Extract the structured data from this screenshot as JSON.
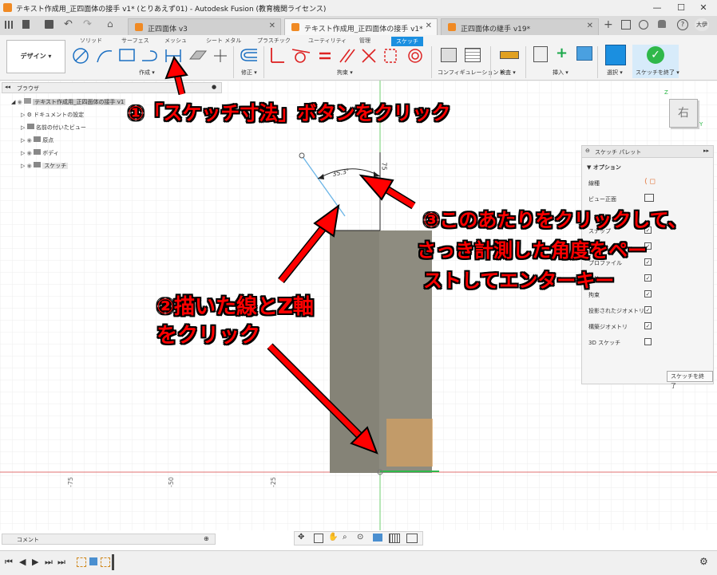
{
  "window": {
    "title": "テキスト作成用_正四面体の接手 v1* (とりあえず01) - Autodesk Fusion (教育機関ライセンス)",
    "minimize": "—",
    "maximize": "☐",
    "close": "✕"
  },
  "tabs": [
    {
      "label": "正四面体 v3"
    },
    {
      "label": "テキスト作成用_正四面体の接手 v1*"
    },
    {
      "label": "正四面体の継手 v19*"
    }
  ],
  "user": {
    "initials": "大伊"
  },
  "toolbar": {
    "workspace": "デザイン ▾",
    "tabs": [
      "ソリッド",
      "サーフェス",
      "メッシュ",
      "シート メタル",
      "プラスチック",
      "ユーティリティ",
      "管理",
      "スケッチ"
    ],
    "groups": [
      "作成 ▾",
      "修正 ▾",
      "拘束 ▾",
      "コンフィギュレーション ▾",
      "検査 ▾",
      "挿入 ▾",
      "選択 ▾",
      "スケッチを終了 ▾"
    ]
  },
  "browser": {
    "title": "ブラウザ",
    "root": "テキスト作成用_正四面体の接手 v1",
    "items": [
      "ドキュメントの設定",
      "名前の付いたビュー",
      "原点",
      "ボディ",
      "スケッチ"
    ]
  },
  "viewcube": {
    "face": "右"
  },
  "dimension": {
    "angle": "35.3°",
    "vertical": "75"
  },
  "axis_ticks": [
    "-75",
    "-50",
    "-25"
  ],
  "annotations": {
    "step1": "①「スケッチ寸法」ボタンをクリック",
    "step2_line1": "②描いた線とZ軸",
    "step2_line2": "をクリック",
    "step3_line1": "③このあたりをクリックして、",
    "step3_line2": "さっき計測した角度をペー",
    "step3_line3": "ストしてエンターキー"
  },
  "palette": {
    "title": "スケッチ パレット",
    "options_header": "▼ オプション",
    "rows": [
      {
        "label": "線種",
        "checked": null
      },
      {
        "label": "ビュー正面",
        "checked": null
      },
      {
        "label": "スナップ",
        "checked": true
      },
      {
        "label": "",
        "checked": true
      },
      {
        "label": "プロファイル",
        "checked": true
      },
      {
        "label": "寸法",
        "checked": true
      },
      {
        "label": "拘束",
        "checked": true
      },
      {
        "label": "投影されたジオメトリ",
        "checked": true
      },
      {
        "label": "構築ジオメトリ",
        "checked": true
      },
      {
        "label": "3D スケッチ",
        "checked": false
      }
    ],
    "finish_button": "スケッチを終了"
  },
  "comment_panel": {
    "title": "コメント"
  },
  "colors": {
    "accent": "#1b8fe0",
    "annotation": "#ff0000",
    "sketch_finish": "#2fb84a",
    "body": "#8e8c80"
  }
}
